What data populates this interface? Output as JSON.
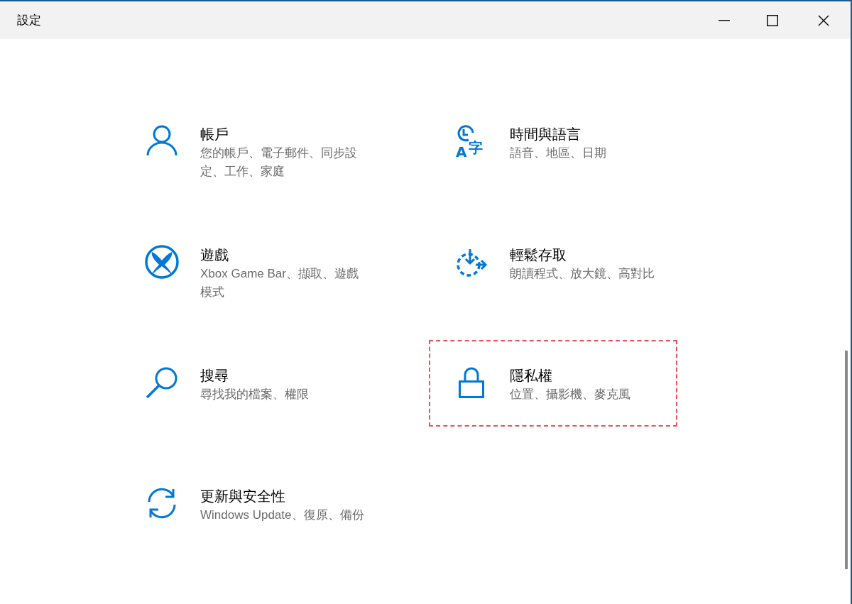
{
  "window": {
    "title": "設定"
  },
  "categories": [
    {
      "kind": "person",
      "title": "帳戶",
      "subtitle": "您的帳戶、電子郵件、同步設定、工作、家庭",
      "highlighted": false
    },
    {
      "kind": "time-language",
      "icon_letters": [
        "A",
        "字"
      ],
      "title": "時間與語言",
      "subtitle": "語音、地區、日期",
      "highlighted": false
    },
    {
      "kind": "xbox",
      "title": "遊戲",
      "subtitle": "Xbox Game Bar、擷取、遊戲模式",
      "highlighted": false
    },
    {
      "kind": "accessibility",
      "title": "輕鬆存取",
      "subtitle": "朗讀程式、放大鏡、高對比",
      "highlighted": false
    },
    {
      "kind": "search",
      "title": "搜尋",
      "subtitle": "尋找我的檔案、權限",
      "highlighted": false
    },
    {
      "kind": "lock",
      "title": "隱私權",
      "subtitle": "位置、攝影機、麥克風",
      "highlighted": true
    },
    {
      "kind": "update",
      "title": "更新與安全性",
      "subtitle": "Windows Update、復原、備份",
      "highlighted": false
    }
  ]
}
